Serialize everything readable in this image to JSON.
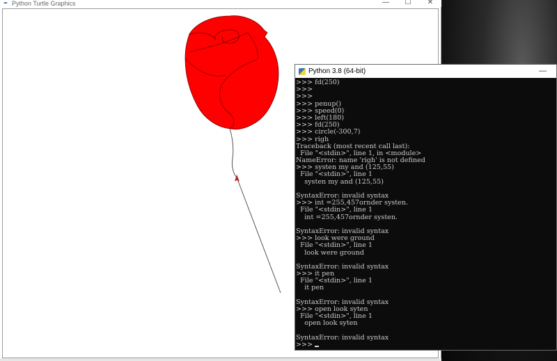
{
  "turtle_window": {
    "title": "Python Turtle Graphics",
    "controls": {
      "minimize": "—",
      "maximize": "☐",
      "close": "✕"
    },
    "drawing": {
      "subject": "rose",
      "petal_color": "#ff0000",
      "stem_color": "#555555",
      "turtle_color": "#b22222"
    }
  },
  "python_window": {
    "title": "Python 3.8 (64-bit)",
    "minimize": "—",
    "console_lines": [
      ">>> fd(250)",
      ">>>",
      ">>>",
      ">>> penup()",
      ">>> speed(0)",
      ">>> left(180)",
      ">>> fd(250)",
      ">>> circle(-300,7)",
      ">>> righ",
      "Traceback (most recent call last):",
      "  File \"<stdin>\", line 1, in <module>",
      "NameError: name 'righ' is not defined",
      ">>> systen my and (125,55)",
      "  File \"<stdin>\", line 1",
      "    systen my and (125,55)",
      "",
      "SyntaxError: invalid syntax",
      ">>> int =255,457ornder systen.",
      "  File \"<stdin>\", line 1",
      "    int =255,457ornder systen.",
      "",
      "SyntaxError: invalid syntax",
      ">>> look were ground",
      "  File \"<stdin>\", line 1",
      "    look were ground",
      "",
      "SyntaxError: invalid syntax",
      ">>> it pen",
      "  File \"<stdin>\", line 1",
      "    it pen",
      "",
      "SyntaxError: invalid syntax",
      ">>> open look syten",
      "  File \"<stdin>\", line 1",
      "    open look syten",
      "",
      "SyntaxError: invalid syntax"
    ],
    "prompt": ">>>"
  }
}
